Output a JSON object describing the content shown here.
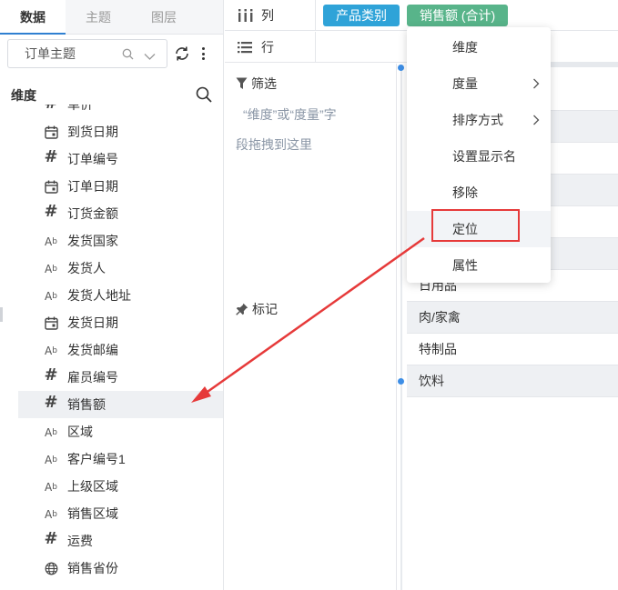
{
  "tabs": [
    {
      "label": "数据",
      "active": true
    },
    {
      "label": "主题",
      "active": false
    },
    {
      "label": "图层",
      "active": false
    }
  ],
  "subject_select": {
    "value": "订单主题"
  },
  "dimension_section": {
    "title": "维度"
  },
  "fields": [
    {
      "label": "单价",
      "type": "number"
    },
    {
      "label": "到货日期",
      "type": "date"
    },
    {
      "label": "订单编号",
      "type": "number"
    },
    {
      "label": "订单日期",
      "type": "date"
    },
    {
      "label": "订货金额",
      "type": "number"
    },
    {
      "label": "发货国家",
      "type": "text"
    },
    {
      "label": "发货人",
      "type": "text"
    },
    {
      "label": "发货人地址",
      "type": "text"
    },
    {
      "label": "发货日期",
      "type": "date"
    },
    {
      "label": "发货邮编",
      "type": "text"
    },
    {
      "label": "雇员编号",
      "type": "number"
    },
    {
      "label": "销售额",
      "type": "number"
    },
    {
      "label": "区域",
      "type": "text"
    },
    {
      "label": "客户编号1",
      "type": "text"
    },
    {
      "label": "上级区域",
      "type": "text"
    },
    {
      "label": "销售区域",
      "type": "text"
    },
    {
      "label": "运费",
      "type": "number"
    },
    {
      "label": "销售省份",
      "type": "geo"
    }
  ],
  "shelves": {
    "columns": {
      "label": "列",
      "pills": [
        "产品类别",
        "销售额 (合计)"
      ]
    },
    "rows": {
      "label": "行"
    }
  },
  "filter": {
    "title": "筛选",
    "hint_line1": "“维度”或“度量”字",
    "hint_line2": "段拖拽到这里"
  },
  "marks": {
    "title": "标记"
  },
  "table_rows": [
    "",
    "",
    "",
    "",
    "",
    "",
    "日用品",
    "肉/家禽",
    "特制品",
    "饮料"
  ],
  "context_menu": {
    "items": [
      {
        "label": "维度",
        "submenu": false
      },
      {
        "label": "度量",
        "submenu": true
      },
      {
        "label": "排序方式",
        "submenu": true
      },
      {
        "label": "设置显示名",
        "submenu": false
      },
      {
        "label": "移除",
        "submenu": false
      },
      {
        "label": "定位",
        "submenu": false
      },
      {
        "label": "属性",
        "submenu": false
      }
    ]
  },
  "colors": {
    "accent": "#2f80d1",
    "pill_blue": "#2fa3d8",
    "pill_green": "#58b48a",
    "annotation_red": "#e63a3a"
  }
}
